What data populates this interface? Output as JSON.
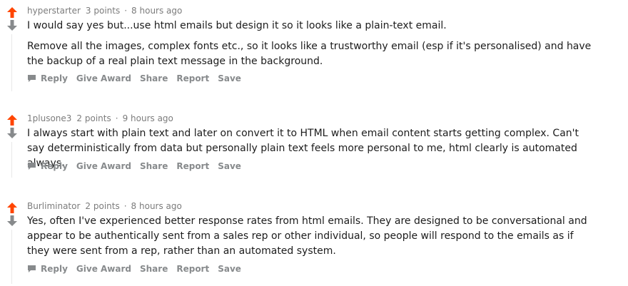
{
  "comments": [
    {
      "author": "hyperstarter",
      "points": "3 points",
      "separator": "·",
      "time": "8 hours ago",
      "paragraphs": [
        "I would say yes but...use html emails but design it so it looks like a plain-text email.",
        "Remove all the images, complex fonts etc., so it looks like a trustworthy email (esp if it's personalised) and have the backup of a real plain text message in the background."
      ]
    },
    {
      "author": "1plusone3",
      "points": "2 points",
      "separator": "·",
      "time": "9 hours ago",
      "paragraphs": [
        "I always start with plain text and later on convert it to HTML when email content starts getting complex. Can't say deterministically from data but personally plain text feels more personal to me, html clearly is automated always."
      ]
    },
    {
      "author": "Burliminator",
      "points": "2 points",
      "separator": "·",
      "time": "8 hours ago",
      "paragraphs": [
        "Yes, often I've experienced better response rates from html emails. They are designed to be conversational and appear to be authentically sent from a sales rep or other individual, so people will respond to the emails as if they were sent from a rep, rather than an automated system."
      ]
    }
  ],
  "actions": {
    "reply": "Reply",
    "give_award": "Give Award",
    "share": "Share",
    "report": "Report",
    "save": "Save"
  },
  "colors": {
    "upvote": "#ff4500",
    "downvote": "#878a8c",
    "meta_text": "#7c7c7c",
    "action_text": "#878a8c",
    "body_text": "#1c1c1c"
  },
  "icons": {
    "upvote": "upvote-arrow-icon",
    "downvote": "downvote-arrow-icon",
    "reply": "speech-bubble-icon"
  }
}
